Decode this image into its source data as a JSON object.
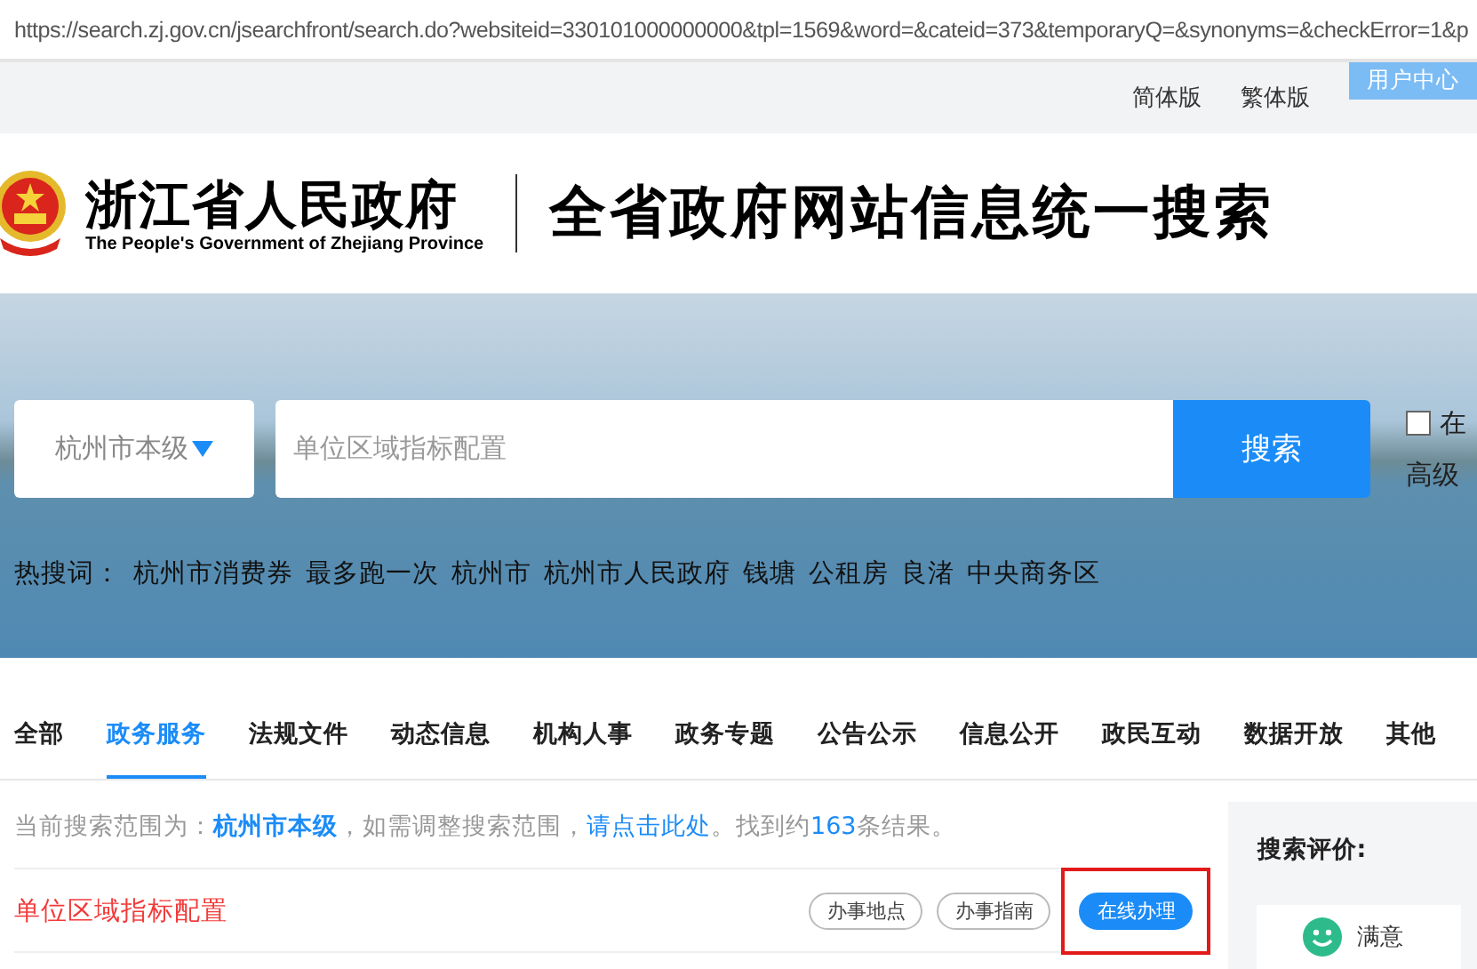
{
  "address_bar": {
    "url": "https://search.zj.gov.cn/jsearchfront/search.do?websiteid=330101000000000&tpl=1569&word=&cateid=373&temporaryQ=&synonyms=&checkError=1&p"
  },
  "top_links": [
    {
      "label": "简体版",
      "kind": "link"
    },
    {
      "label": "繁体版",
      "kind": "link"
    },
    {
      "label": "用户中心",
      "kind": "button"
    }
  ],
  "header": {
    "org_name": "浙江省人民政府",
    "org_name_en": "The People's Government of Zhejiang Province",
    "site_title": "全省政府网站信息统一搜索"
  },
  "search": {
    "scope": "杭州市本级",
    "value": "单位区域指标配置",
    "button": "搜索",
    "option_checked": false,
    "option_label": "在",
    "advanced": "高级"
  },
  "hot_words": {
    "label": "热搜词：",
    "words": [
      "杭州市消费券",
      "最多跑一次",
      "杭州市",
      "杭州市人民政府",
      "钱塘",
      "公租房",
      "良渚",
      "中央商务区"
    ]
  },
  "tabs": [
    {
      "label": "全部",
      "selected": false
    },
    {
      "label": "政务服务",
      "selected": true
    },
    {
      "label": "法规文件",
      "selected": false
    },
    {
      "label": "动态信息",
      "selected": false
    },
    {
      "label": "机构人事",
      "selected": false
    },
    {
      "label": "政务专题",
      "selected": false
    },
    {
      "label": "公告公示",
      "selected": false
    },
    {
      "label": "信息公开",
      "selected": false
    },
    {
      "label": "政民互动",
      "selected": false
    },
    {
      "label": "数据开放",
      "selected": false
    },
    {
      "label": "其他",
      "selected": false
    }
  ],
  "summary": {
    "prefix": "当前搜索范围为：",
    "scope": "杭州市本级",
    "middle": "，如需调整搜索范围，",
    "link": "请点击此处",
    "found": "。找到约",
    "count": "163",
    "end": "条结果。"
  },
  "results": [
    {
      "title": "单位区域指标配置",
      "actions": [
        {
          "label": "办事地点",
          "primary": false,
          "highlighted": false
        },
        {
          "label": "办事指南",
          "primary": false,
          "highlighted": false
        },
        {
          "label": "在线办理",
          "primary": true,
          "highlighted": true
        }
      ]
    }
  ],
  "rating": {
    "title": "搜索评价:",
    "options": [
      {
        "label": "满意"
      }
    ]
  }
}
